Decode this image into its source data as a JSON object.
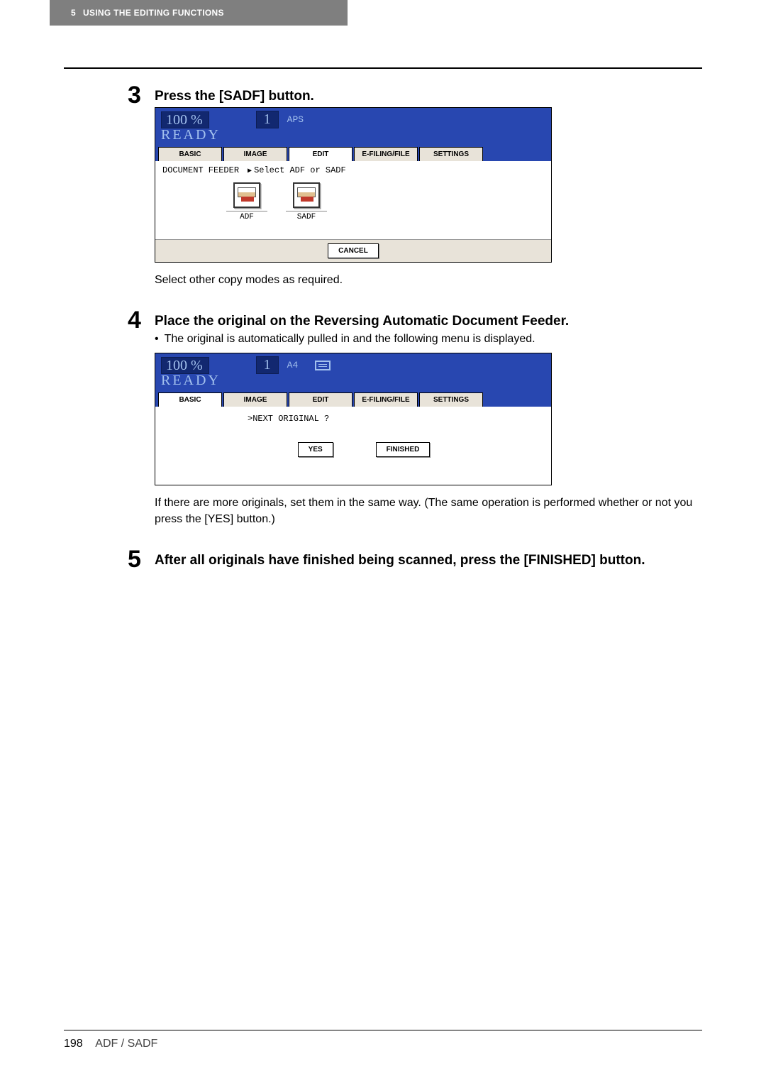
{
  "header": {
    "chapter": "5",
    "title": "USING THE EDITING FUNCTIONS"
  },
  "step3": {
    "number": "3",
    "title": "Press the [SADF] button.",
    "panel": {
      "percent": "100 %",
      "qty": "1",
      "mode": "APS",
      "ready": "READY",
      "tabs": {
        "basic": "BASIC",
        "image": "IMAGE",
        "edit": "EDIT",
        "efiling": "E-FILING/FILE",
        "settings": "SETTINGS"
      },
      "doc_feeder_label": "DOCUMENT FEEDER",
      "select_label": "Select ADF or SADF",
      "adf_label": "ADF",
      "sadf_label": "SADF",
      "cancel": "CANCEL"
    },
    "after_text": "Select other copy modes as required."
  },
  "step4": {
    "number": "4",
    "title": "Place the original on the Reversing Automatic Document Feeder.",
    "bullet": "The original is automatically pulled in and the following menu is displayed.",
    "panel": {
      "percent": "100 %",
      "qty": "1",
      "mode": "A4",
      "ready": "READY",
      "tabs": {
        "basic": "BASIC",
        "image": "IMAGE",
        "edit": "EDIT",
        "efiling": "E-FILING/FILE",
        "settings": "SETTINGS"
      },
      "next_original": ">NEXT ORIGINAL ?",
      "yes": "YES",
      "finished": "FINISHED"
    },
    "after_text": "If there are more originals, set them in the same way. (The same operation is performed whether or not you press the [YES] button.)"
  },
  "step5": {
    "number": "5",
    "title": "After all originals have finished being scanned, press the [FINISHED] button."
  },
  "footer": {
    "page": "198",
    "section": "ADF / SADF"
  }
}
